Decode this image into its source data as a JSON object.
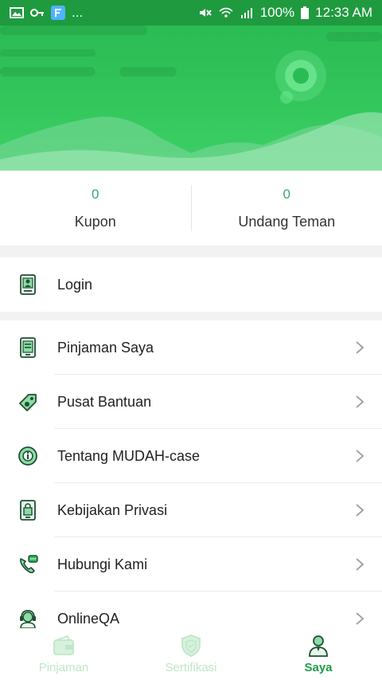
{
  "status_bar": {
    "left_indicator": "...",
    "battery": "100%",
    "time": "12:33 AM"
  },
  "stats": [
    {
      "value": "0",
      "label": "Kupon"
    },
    {
      "value": "0",
      "label": "Undang Teman"
    }
  ],
  "login": {
    "label": "Login",
    "icon": "user-card-icon"
  },
  "menu": [
    {
      "label": "Pinjaman Saya",
      "icon": "phone-list-icon"
    },
    {
      "label": "Pusat Bantuan",
      "icon": "tag-icon"
    },
    {
      "label": "Tentang MUDAH-case",
      "icon": "info-badge-icon"
    },
    {
      "label": "Kebijakan Privasi",
      "icon": "lock-phone-icon"
    },
    {
      "label": "Hubungi Kami",
      "icon": "phone-chat-icon"
    },
    {
      "label": "OnlineQA",
      "icon": "headset-agent-icon"
    }
  ],
  "tabs": [
    {
      "label": "Pinjaman",
      "icon": "wallet-icon",
      "active": false
    },
    {
      "label": "Sertifikasi",
      "icon": "shield-icon",
      "active": false
    },
    {
      "label": "Saya",
      "icon": "person-icon",
      "active": true
    }
  ],
  "colors": {
    "primary": "#2bbb54",
    "status_bar": "#1f9a3f",
    "accent_text": "#3aa76b",
    "inactive_tab": "#bfe6c8",
    "active_tab": "#1e9c48"
  }
}
